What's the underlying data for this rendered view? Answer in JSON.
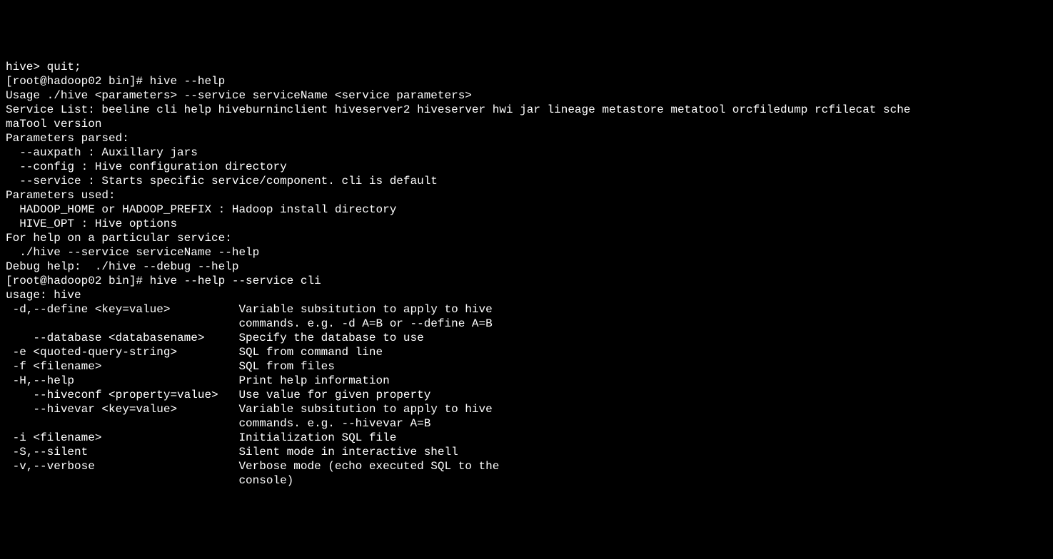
{
  "lines": [
    "hive> quit;",
    "[root@hadoop02 bin]# hive --help",
    "Usage ./hive <parameters> --service serviceName <service parameters>",
    "Service List: beeline cli help hiveburninclient hiveserver2 hiveserver hwi jar lineage metastore metatool orcfiledump rcfilecat sche",
    "maTool version",
    "Parameters parsed:",
    "  --auxpath : Auxillary jars",
    "  --config : Hive configuration directory",
    "  --service : Starts specific service/component. cli is default",
    "Parameters used:",
    "  HADOOP_HOME or HADOOP_PREFIX : Hadoop install directory",
    "  HIVE_OPT : Hive options",
    "For help on a particular service:",
    "  ./hive --service serviceName --help",
    "Debug help:  ./hive --debug --help",
    "[root@hadoop02 bin]# hive --help --service cli",
    "usage: hive",
    " -d,--define <key=value>          Variable subsitution to apply to hive",
    "                                  commands. e.g. -d A=B or --define A=B",
    "    --database <databasename>     Specify the database to use",
    " -e <quoted-query-string>         SQL from command line",
    " -f <filename>                    SQL from files",
    " -H,--help                        Print help information",
    "    --hiveconf <property=value>   Use value for given property",
    "    --hivevar <key=value>         Variable subsitution to apply to hive",
    "                                  commands. e.g. --hivevar A=B",
    " -i <filename>                    Initialization SQL file",
    " -S,--silent                      Silent mode in interactive shell",
    " -v,--verbose                     Verbose mode (echo executed SQL to the",
    "                                  console)"
  ]
}
